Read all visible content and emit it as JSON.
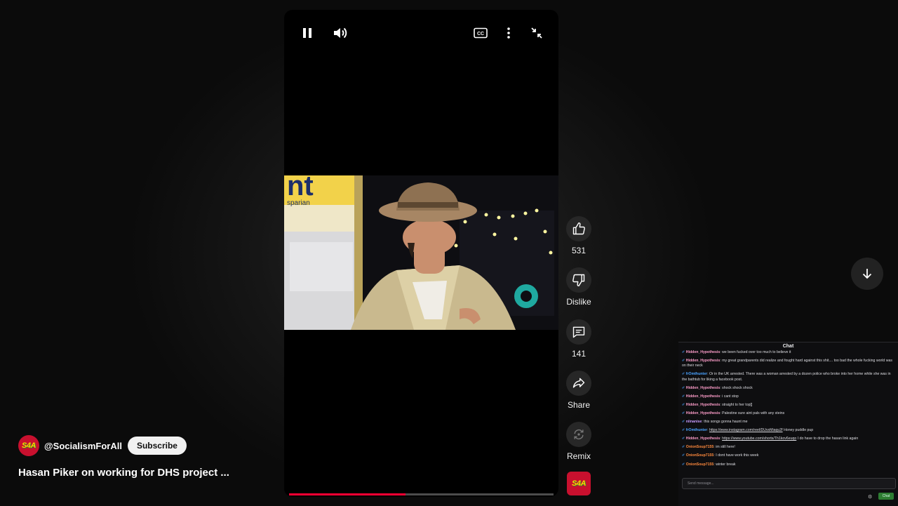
{
  "player": {
    "controls": {
      "pause_icon": "pause-icon",
      "volume_icon": "volume-icon",
      "captions_icon": "cc-icon",
      "more_icon": "more-vert-icon",
      "exit_fullscreen_icon": "exit-fullscreen-icon"
    },
    "progress_fraction": 0.44,
    "accent_color": "#ff0033"
  },
  "actions": {
    "like_count": "531",
    "dislike_label": "Dislike",
    "comments_count": "141",
    "share_label": "Share",
    "remix_label": "Remix"
  },
  "channel": {
    "avatar_text": "S4A",
    "handle": "@SocialismForAll",
    "subscribe_label": "Subscribe"
  },
  "video": {
    "title": "Hasan Piker on working for DHS project ...",
    "frame_sign_text": "nt",
    "frame_sign_subtext": "sparian"
  },
  "chat": {
    "title": "Chat",
    "input_placeholder": "Send message...",
    "send_label": "Chat",
    "messages": [
      {
        "user": "Hidden_Hypothesis",
        "color": "#ff9ecb",
        "text": "we been fucked over too much to believe it"
      },
      {
        "user": "Hidden_Hypothesis",
        "color": "#ff9ecb",
        "text": "my great grandparents did realize and fought hard against this shit.... too bad the whole fucking world was on their neck"
      },
      {
        "user": "frOmthunter",
        "color": "#4aa3ff",
        "text": "Or in the UK arrested. There was a woman arrested by a dozen police who broke into her home while she was in the bathtub for liking a facebook post."
      },
      {
        "user": "Hidden_Hypothesis",
        "color": "#ff9ecb",
        "text": "shock shock shock"
      },
      {
        "user": "Hidden_Hypothesis",
        "color": "#ff9ecb",
        "text": "i cant stop"
      },
      {
        "user": "Hidden_Hypothesis",
        "color": "#ff9ecb",
        "text": "straight to her top[]"
      },
      {
        "user": "Hidden_Hypothesis",
        "color": "#ff9ecb",
        "text": "Palestine sure aint pals with any steins"
      },
      {
        "user": "niinanise",
        "color": "#c89cff",
        "text": "this songs gonna haunt me"
      },
      {
        "user": "frOmthunter",
        "color": "#4aa3ff",
        "link": "https://www.instagram.com/reel/DUvsMiaqu2f",
        "text": "Honey puddle pup"
      },
      {
        "user": "Hidden_Hypothesis",
        "color": "#ff9ecb",
        "link": "https://www.youtube.com/shorts/Th1kov6euqo",
        "text": "I do have to drop the hasan link again"
      },
      {
        "user": "OnionSoup7155",
        "color": "#ff8a3d",
        "text": "im still here!"
      },
      {
        "user": "OnionSoup7155",
        "color": "#ff8a3d",
        "text": "I dont have work this week"
      },
      {
        "user": "OnionSoup7155",
        "color": "#ff8a3d",
        "text": "winter break"
      }
    ]
  }
}
